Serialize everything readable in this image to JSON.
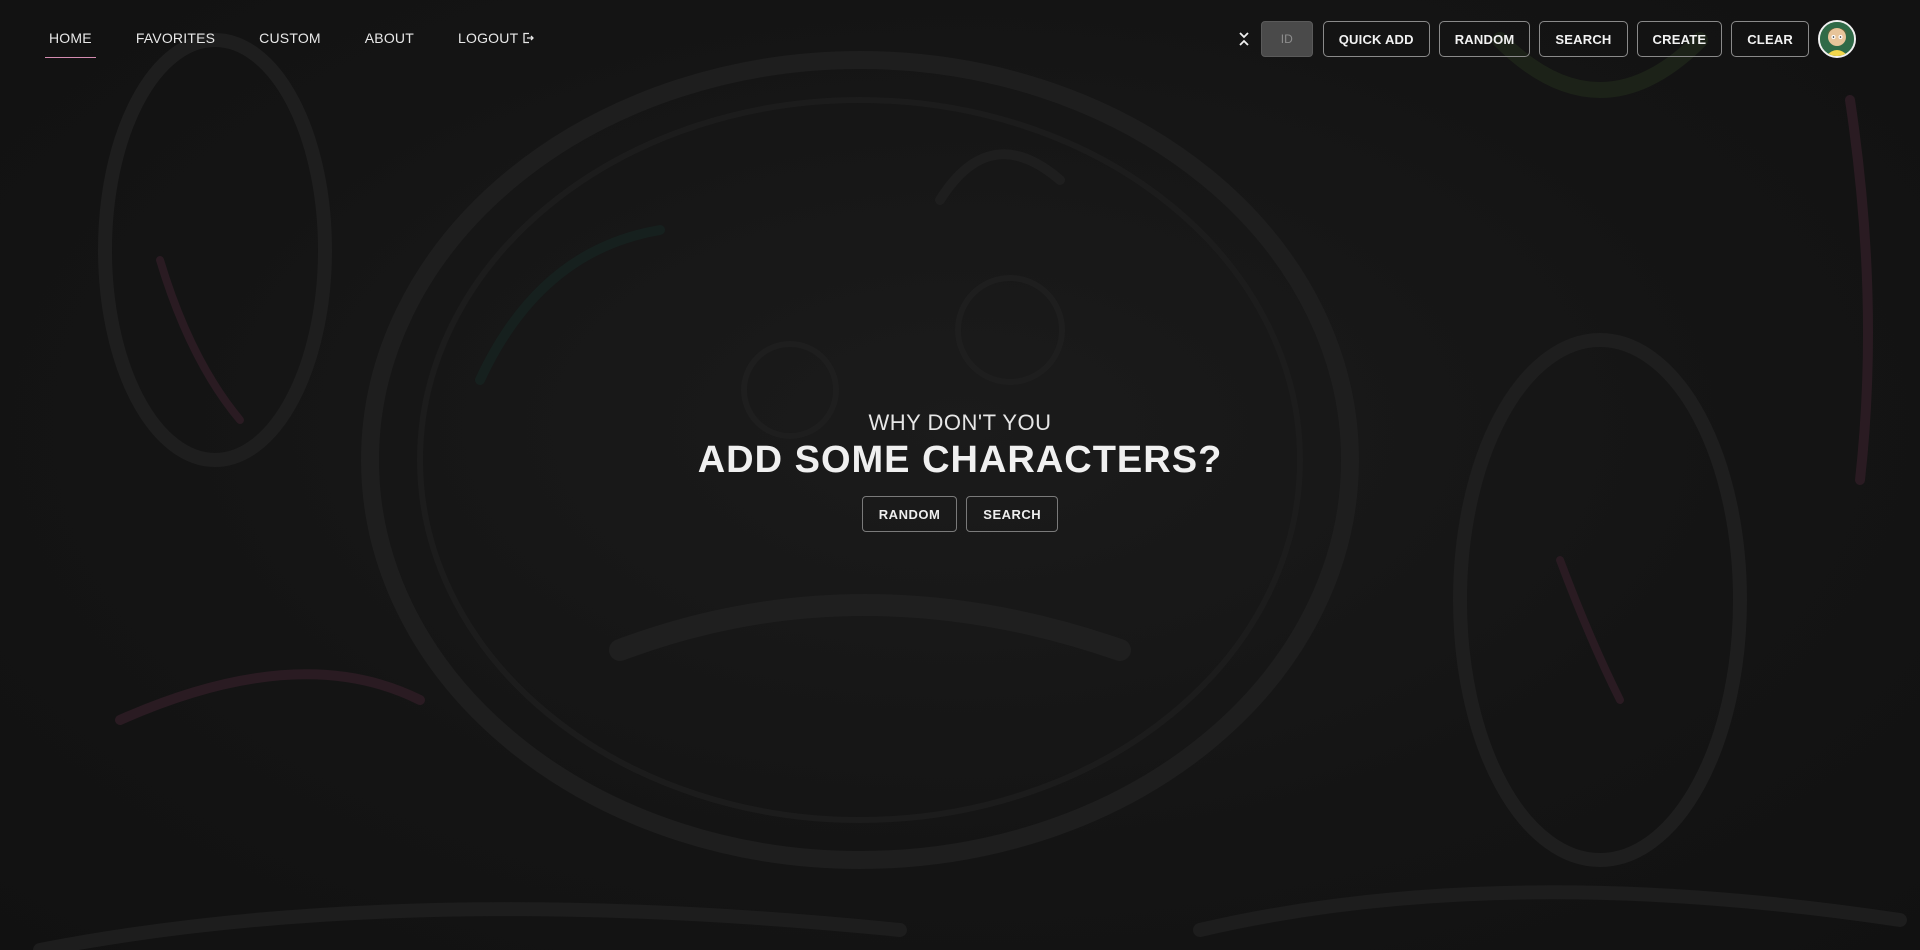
{
  "nav": {
    "links": [
      {
        "label": "HOME",
        "active": true
      },
      {
        "label": "FAVORITES",
        "active": false
      },
      {
        "label": "CUSTOM",
        "active": false
      },
      {
        "label": "ABOUT",
        "active": false
      },
      {
        "label": "LOGOUT",
        "active": false
      }
    ]
  },
  "toolbar": {
    "id_placeholder": "ID",
    "quick_add": "QUICK ADD",
    "random": "RANDOM",
    "search": "SEARCH",
    "create": "CREATE",
    "clear": "CLEAR"
  },
  "hero": {
    "subtitle": "WHY DON'T YOU",
    "title": "ADD SOME CHARACTERS?",
    "random_button": "RANDOM",
    "search_button": "SEARCH"
  },
  "icons": {
    "logout": "logout-icon",
    "collapse": "collapse-chevrons-icon",
    "avatar": "user-avatar"
  },
  "colors": {
    "background": "#161616",
    "active_underline": "#d48bb0",
    "button_border": "#8a8a8a",
    "text": "#e6e6e6"
  }
}
